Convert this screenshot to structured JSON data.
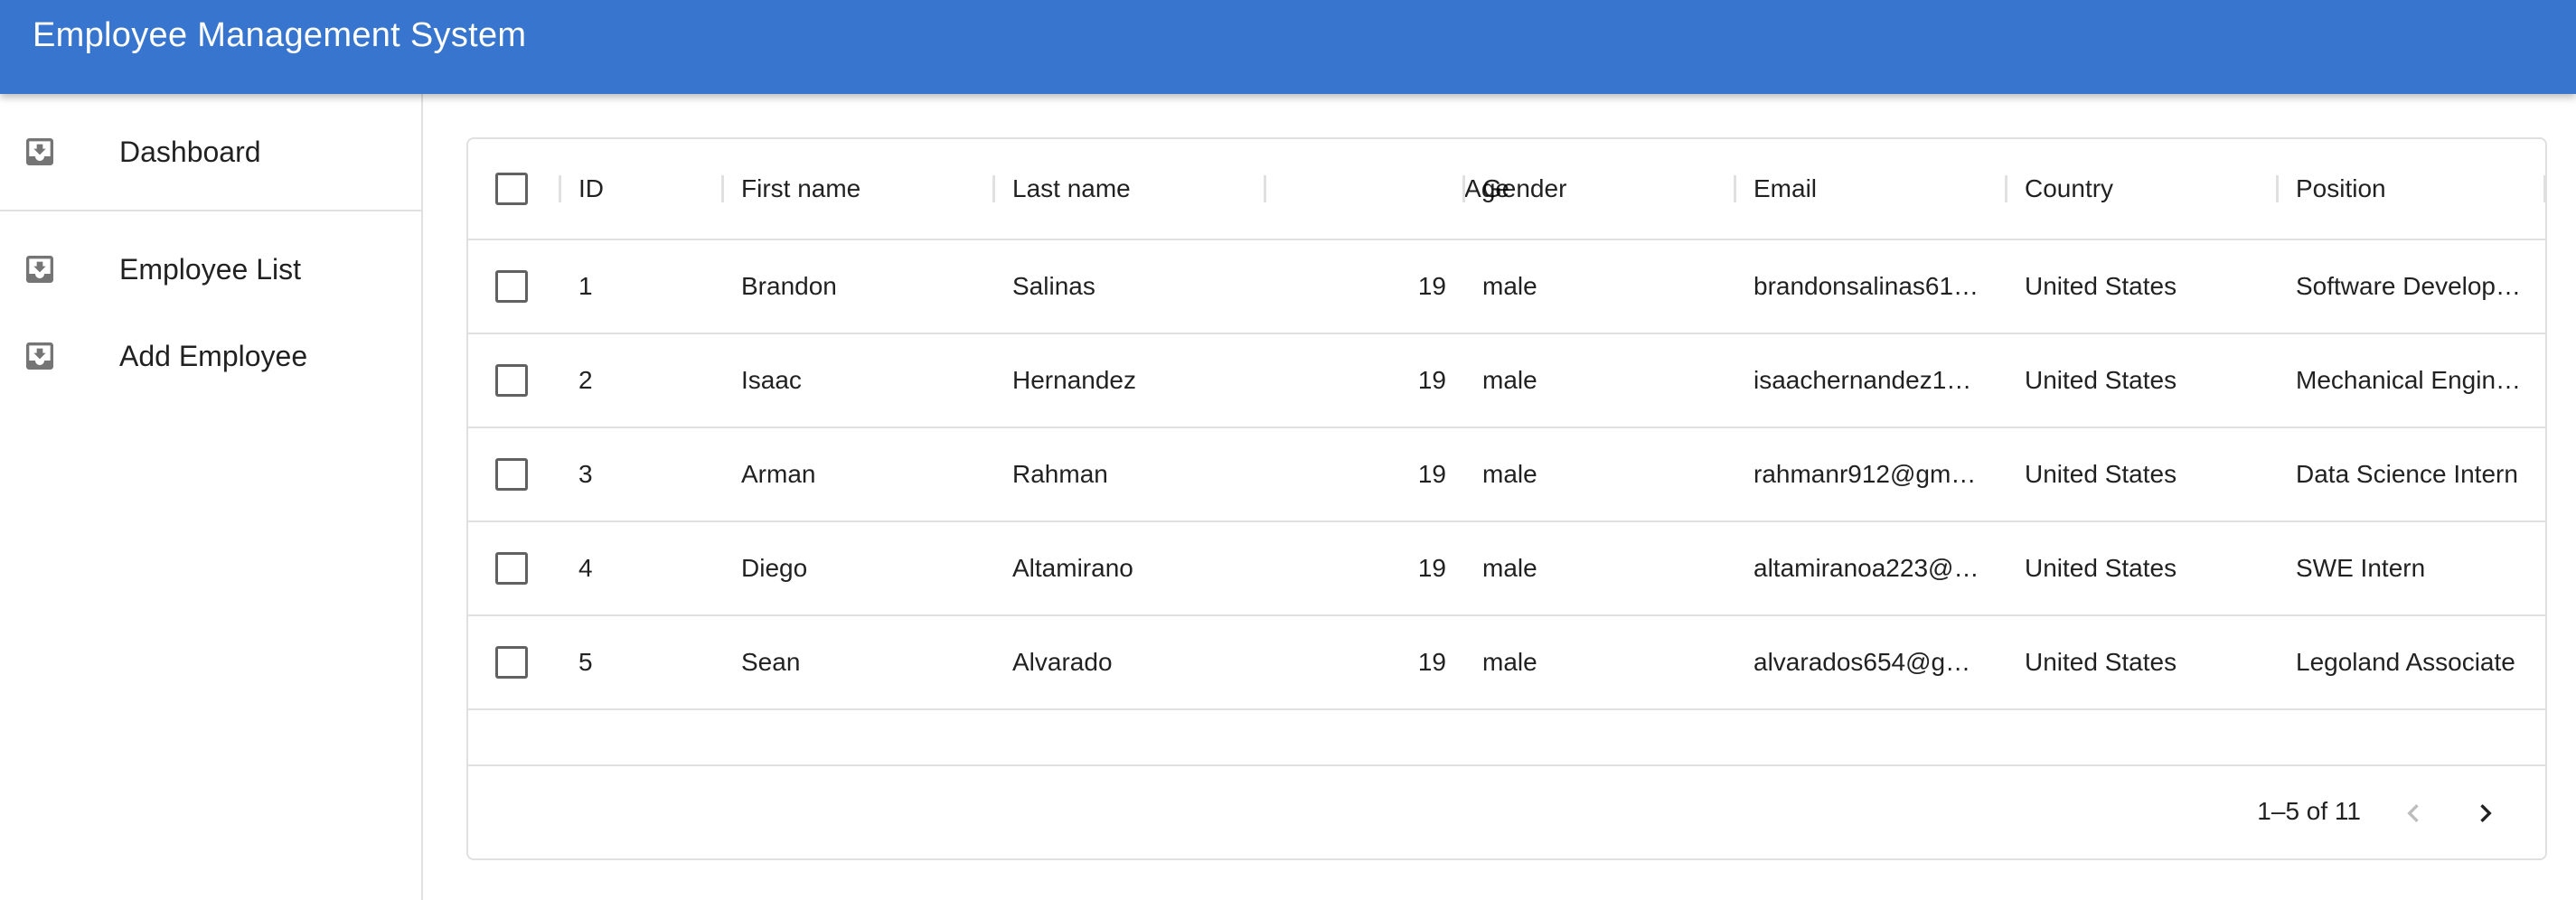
{
  "app": {
    "title": "Employee Management System",
    "accent": "#3875cf"
  },
  "sidebar": {
    "items": [
      {
        "label": "Dashboard",
        "icon": "move-to-inbox-icon"
      },
      {
        "label": "Employee List",
        "icon": "move-to-inbox-icon"
      },
      {
        "label": "Add Employee",
        "icon": "move-to-inbox-icon"
      }
    ]
  },
  "table": {
    "columns": [
      "ID",
      "First name",
      "Last name",
      "Age",
      "Gender",
      "Email",
      "Country",
      "Position"
    ],
    "rows": [
      {
        "id": "1",
        "first": "Brandon",
        "last": "Salinas",
        "age": "19",
        "gender": "male",
        "email": "brandonsalinas61…",
        "country": "United States",
        "position": "Software Develop…"
      },
      {
        "id": "2",
        "first": "Isaac",
        "last": "Hernandez",
        "age": "19",
        "gender": "male",
        "email": "isaachernandez1…",
        "country": "United States",
        "position": "Mechanical Engin…"
      },
      {
        "id": "3",
        "first": "Arman",
        "last": "Rahman",
        "age": "19",
        "gender": "male",
        "email": "rahmanr912@gm…",
        "country": "United States",
        "position": "Data Science Intern"
      },
      {
        "id": "4",
        "first": "Diego",
        "last": "Altamirano",
        "age": "19",
        "gender": "male",
        "email": "altamiranoa223@…",
        "country": "United States",
        "position": "SWE Intern"
      },
      {
        "id": "5",
        "first": "Sean",
        "last": "Alvarado",
        "age": "19",
        "gender": "male",
        "email": "alvarados654@g…",
        "country": "United States",
        "position": "Legoland Associate"
      }
    ]
  },
  "pagination": {
    "info": "1–5 of 11",
    "prev_icon": "chevron-left-icon",
    "next_icon": "chevron-right-icon"
  }
}
